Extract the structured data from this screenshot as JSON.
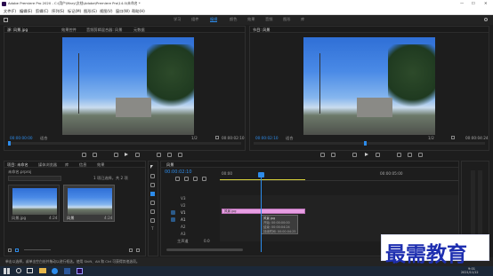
{
  "title": "Adobe Premiere Pro 2020 - C:\\用户\\Mary\\文档\\Adobe\\Premiere Pro\\14.0\\未命名 *",
  "menu": [
    "文件(F)",
    "编辑(E)",
    "剪辑(C)",
    "序列(S)",
    "标记(M)",
    "图形(G)",
    "视图(V)",
    "窗口(W)",
    "帮助(H)"
  ],
  "workspaces": [
    "学习",
    "组件",
    "编辑",
    "颜色",
    "效果",
    "音频",
    "图形",
    "库"
  ],
  "source_panel": {
    "tabs": [
      "源: 风景.jpg",
      "效果控件",
      "音频剪辑混合器: 风景",
      "元数据"
    ],
    "timecode": "00:00:00:00",
    "fit": "适合",
    "ratio": "1/2",
    "duration": "00:00:02:10"
  },
  "program_panel": {
    "tab": "节目: 风景",
    "timecode_left": "00:00:02:10",
    "fit": "适合",
    "ratio": "1/2",
    "timecode_right": "00:00:04:24"
  },
  "project_panel": {
    "tabs": [
      "项目: 未命名",
      "媒体浏览器",
      "库",
      "信息",
      "效果"
    ],
    "project_name": "未命名.prproj",
    "count": "1 项已选择，共 2 项",
    "items": [
      {
        "name": "风景.jpg",
        "duration": "4:24"
      },
      {
        "name": "风景",
        "duration": "4:24"
      }
    ]
  },
  "timeline": {
    "tab": "风景",
    "timecode": "00:00:02:10",
    "ruler": [
      "00:00",
      "00:00:05:00"
    ],
    "tracks": [
      "V3",
      "V2",
      "V1",
      "A1",
      "A2",
      "A3"
    ],
    "master": "主声道",
    "master_val": "0.0",
    "clip_name": "风景.jpg",
    "tooltip": [
      "风景.jpg",
      "开始: 00:00:00:00",
      "结束: 00:00:04:24",
      "持续时间: 00:00:04:25"
    ]
  },
  "statusbar": "单击以选择，或单击空白处并拖动以进行框选。使用 Shift、Alt 和 Ctrl 可获得其他选项。",
  "watermark": "最需教育",
  "taskbar": {
    "time": "9:01",
    "date": "2021/11/12"
  }
}
